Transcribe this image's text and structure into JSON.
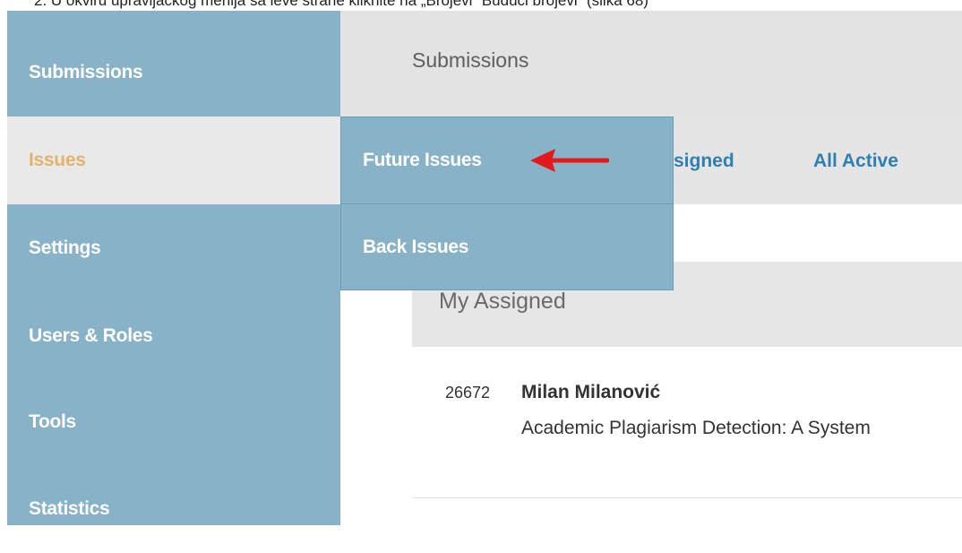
{
  "caption": "2. U okviru upravljačkog menija sa leve strane kliknite na „Brojevi” Budući brojevi” (slika 68)",
  "sidebar": {
    "items": [
      {
        "label": "Submissions"
      },
      {
        "label": "Issues"
      },
      {
        "label": "Settings"
      },
      {
        "label": "Users & Roles"
      },
      {
        "label": "Tools"
      },
      {
        "label": "Statistics"
      }
    ],
    "active": "Issues"
  },
  "main": {
    "title": "Submissions",
    "tabs": [
      {
        "label": "signed"
      },
      {
        "label": "All Active"
      }
    ]
  },
  "dropdown": {
    "items": [
      {
        "label": "Future Issues"
      },
      {
        "label": "Back Issues"
      }
    ]
  },
  "panel": {
    "title": "My Assigned",
    "rows": [
      {
        "id": "26672",
        "author": "Milan Milanović",
        "title": "Academic Plagiarism Detection: A System"
      }
    ]
  },
  "annotation": {
    "icon": "red-arrow-icon",
    "color": "#e3191b"
  },
  "colors": {
    "sidebar": "#87b2c8",
    "active_item_text": "#e2b36c",
    "tab_link": "#2f7fb0",
    "header_bg": "#e3e3e3"
  }
}
